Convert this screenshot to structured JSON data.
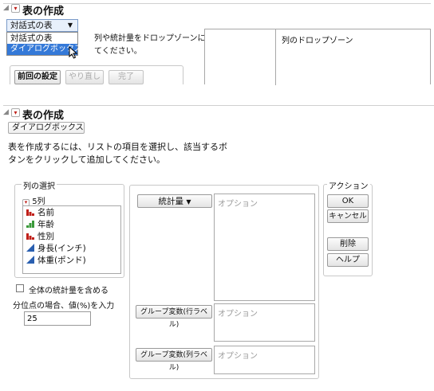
{
  "top_panel": {
    "title": "表の作成",
    "mode_select_value": "対話式の表",
    "dropdown_options": [
      "対話式の表",
      "ダイアログボックス"
    ],
    "highlighted_option_index": 1,
    "instruction_line1": "列や統計量をドロップゾーンにド",
    "instruction_line2": "てください。",
    "drop_zone_label": "列のドロップゾーン",
    "buttons": {
      "previous": "前回の設定",
      "redo": "やり直し",
      "done": "完了"
    }
  },
  "dialog": {
    "title": "表の作成",
    "mode_select_value": "ダイアログボックス",
    "instruction_line1": "表を作成するには、リストの項目を選択し、該当するボ",
    "instruction_line2": "タンをクリックして追加してください。",
    "columns": {
      "group_title": "列の選択",
      "count_label": "5列",
      "items": [
        {
          "label": "名前",
          "icon": "nominal-icon",
          "color": "#c0201a"
        },
        {
          "label": "年齢",
          "icon": "ordinal-icon",
          "color": "#3a9a3a"
        },
        {
          "label": "性別",
          "icon": "nominal-icon",
          "color": "#c0201a"
        },
        {
          "label": "身長(インチ)",
          "icon": "continuous-icon",
          "color": "#2a5fb0"
        },
        {
          "label": "体重(ポンド)",
          "icon": "continuous-icon",
          "color": "#2a5fb0"
        }
      ]
    },
    "include_total_label": "全体の統計量を含める",
    "quantile_label": "分位点の場合、値(%)を入力",
    "quantile_value": "25",
    "stats_button": "統計量",
    "group_row_button": "グループ変数(行ラベル)",
    "group_col_button": "グループ変数(列ラベル)",
    "option_placeholder": "オプション",
    "actions": {
      "group_title": "アクション",
      "ok": "OK",
      "cancel": "キャンセル",
      "remove": "削除",
      "help": "ヘルプ"
    }
  }
}
